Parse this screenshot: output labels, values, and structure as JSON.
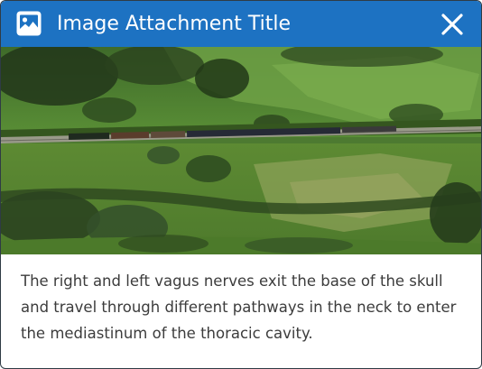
{
  "dialog": {
    "title": "Image Attachment Title",
    "title_icon": "image-icon",
    "close_icon": "close-icon",
    "caption": "The right and left vagus nerves exit the base of the skull and travel through different pathways in the neck to enter the mediastinum of the thoracic cavity."
  },
  "image": {
    "alt_subject": "aerial landscape with train"
  },
  "colors": {
    "header": "#1d72c2",
    "header_text": "#ffffff",
    "caption_text": "#3c3c3c",
    "border": "#2f3b45"
  }
}
